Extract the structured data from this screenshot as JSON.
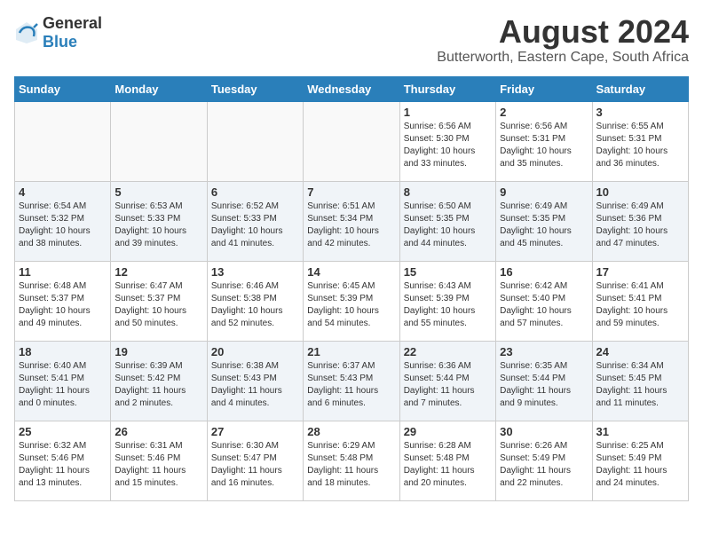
{
  "logo": {
    "general": "General",
    "blue": "Blue"
  },
  "title": "August 2024",
  "subtitle": "Butterworth, Eastern Cape, South Africa",
  "days_of_week": [
    "Sunday",
    "Monday",
    "Tuesday",
    "Wednesday",
    "Thursday",
    "Friday",
    "Saturday"
  ],
  "weeks": [
    [
      {
        "day": "",
        "info": ""
      },
      {
        "day": "",
        "info": ""
      },
      {
        "day": "",
        "info": ""
      },
      {
        "day": "",
        "info": ""
      },
      {
        "day": "1",
        "info": "Sunrise: 6:56 AM\nSunset: 5:30 PM\nDaylight: 10 hours\nand 33 minutes."
      },
      {
        "day": "2",
        "info": "Sunrise: 6:56 AM\nSunset: 5:31 PM\nDaylight: 10 hours\nand 35 minutes."
      },
      {
        "day": "3",
        "info": "Sunrise: 6:55 AM\nSunset: 5:31 PM\nDaylight: 10 hours\nand 36 minutes."
      }
    ],
    [
      {
        "day": "4",
        "info": "Sunrise: 6:54 AM\nSunset: 5:32 PM\nDaylight: 10 hours\nand 38 minutes."
      },
      {
        "day": "5",
        "info": "Sunrise: 6:53 AM\nSunset: 5:33 PM\nDaylight: 10 hours\nand 39 minutes."
      },
      {
        "day": "6",
        "info": "Sunrise: 6:52 AM\nSunset: 5:33 PM\nDaylight: 10 hours\nand 41 minutes."
      },
      {
        "day": "7",
        "info": "Sunrise: 6:51 AM\nSunset: 5:34 PM\nDaylight: 10 hours\nand 42 minutes."
      },
      {
        "day": "8",
        "info": "Sunrise: 6:50 AM\nSunset: 5:35 PM\nDaylight: 10 hours\nand 44 minutes."
      },
      {
        "day": "9",
        "info": "Sunrise: 6:49 AM\nSunset: 5:35 PM\nDaylight: 10 hours\nand 45 minutes."
      },
      {
        "day": "10",
        "info": "Sunrise: 6:49 AM\nSunset: 5:36 PM\nDaylight: 10 hours\nand 47 minutes."
      }
    ],
    [
      {
        "day": "11",
        "info": "Sunrise: 6:48 AM\nSunset: 5:37 PM\nDaylight: 10 hours\nand 49 minutes."
      },
      {
        "day": "12",
        "info": "Sunrise: 6:47 AM\nSunset: 5:37 PM\nDaylight: 10 hours\nand 50 minutes."
      },
      {
        "day": "13",
        "info": "Sunrise: 6:46 AM\nSunset: 5:38 PM\nDaylight: 10 hours\nand 52 minutes."
      },
      {
        "day": "14",
        "info": "Sunrise: 6:45 AM\nSunset: 5:39 PM\nDaylight: 10 hours\nand 54 minutes."
      },
      {
        "day": "15",
        "info": "Sunrise: 6:43 AM\nSunset: 5:39 PM\nDaylight: 10 hours\nand 55 minutes."
      },
      {
        "day": "16",
        "info": "Sunrise: 6:42 AM\nSunset: 5:40 PM\nDaylight: 10 hours\nand 57 minutes."
      },
      {
        "day": "17",
        "info": "Sunrise: 6:41 AM\nSunset: 5:41 PM\nDaylight: 10 hours\nand 59 minutes."
      }
    ],
    [
      {
        "day": "18",
        "info": "Sunrise: 6:40 AM\nSunset: 5:41 PM\nDaylight: 11 hours\nand 0 minutes."
      },
      {
        "day": "19",
        "info": "Sunrise: 6:39 AM\nSunset: 5:42 PM\nDaylight: 11 hours\nand 2 minutes."
      },
      {
        "day": "20",
        "info": "Sunrise: 6:38 AM\nSunset: 5:43 PM\nDaylight: 11 hours\nand 4 minutes."
      },
      {
        "day": "21",
        "info": "Sunrise: 6:37 AM\nSunset: 5:43 PM\nDaylight: 11 hours\nand 6 minutes."
      },
      {
        "day": "22",
        "info": "Sunrise: 6:36 AM\nSunset: 5:44 PM\nDaylight: 11 hours\nand 7 minutes."
      },
      {
        "day": "23",
        "info": "Sunrise: 6:35 AM\nSunset: 5:44 PM\nDaylight: 11 hours\nand 9 minutes."
      },
      {
        "day": "24",
        "info": "Sunrise: 6:34 AM\nSunset: 5:45 PM\nDaylight: 11 hours\nand 11 minutes."
      }
    ],
    [
      {
        "day": "25",
        "info": "Sunrise: 6:32 AM\nSunset: 5:46 PM\nDaylight: 11 hours\nand 13 minutes."
      },
      {
        "day": "26",
        "info": "Sunrise: 6:31 AM\nSunset: 5:46 PM\nDaylight: 11 hours\nand 15 minutes."
      },
      {
        "day": "27",
        "info": "Sunrise: 6:30 AM\nSunset: 5:47 PM\nDaylight: 11 hours\nand 16 minutes."
      },
      {
        "day": "28",
        "info": "Sunrise: 6:29 AM\nSunset: 5:48 PM\nDaylight: 11 hours\nand 18 minutes."
      },
      {
        "day": "29",
        "info": "Sunrise: 6:28 AM\nSunset: 5:48 PM\nDaylight: 11 hours\nand 20 minutes."
      },
      {
        "day": "30",
        "info": "Sunrise: 6:26 AM\nSunset: 5:49 PM\nDaylight: 11 hours\nand 22 minutes."
      },
      {
        "day": "31",
        "info": "Sunrise: 6:25 AM\nSunset: 5:49 PM\nDaylight: 11 hours\nand 24 minutes."
      }
    ]
  ]
}
